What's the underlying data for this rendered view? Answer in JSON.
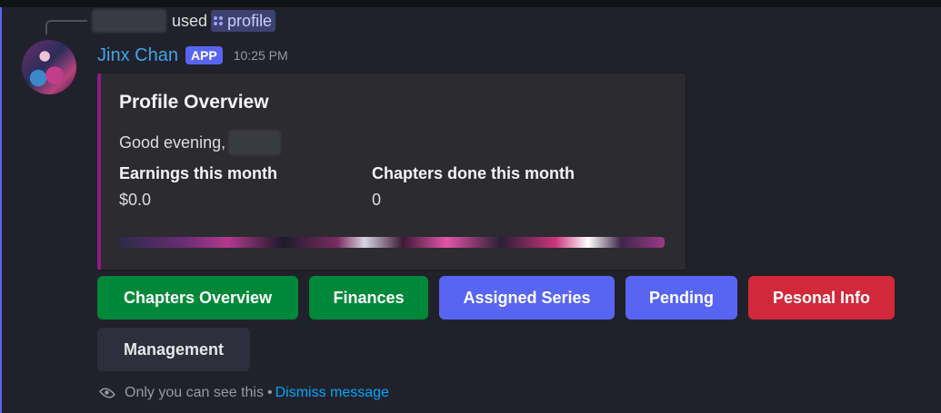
{
  "reply": {
    "used_text": "used",
    "command": "profile",
    "command_icon": "slash-command-icon"
  },
  "message": {
    "author": "Jinx Chan",
    "badge": "APP",
    "timestamp": "10:25 PM",
    "author_color": "#3fa7e6",
    "avatar_icon": "avatar-image"
  },
  "embed": {
    "accent_color": "#8d1d82",
    "title": "Profile Overview",
    "greeting": "Good evening,",
    "fields": [
      {
        "name": "Earnings this month",
        "value": "$0.0"
      },
      {
        "name": "Chapters done this month",
        "value": "0"
      }
    ]
  },
  "buttons": [
    {
      "label": "Chapters Overview",
      "color": "#00883a"
    },
    {
      "label": "Finances",
      "color": "#00883a"
    },
    {
      "label": "Assigned Series",
      "color": "#5865f2"
    },
    {
      "label": "Pending",
      "color": "#5865f2"
    },
    {
      "label": "Pesonal Info",
      "color": "#d1293a"
    },
    {
      "label": "Management",
      "color": "#2e2f3b"
    }
  ],
  "footer": {
    "notice": "Only you can see this",
    "separator": "•",
    "dismiss": "Dismiss message",
    "icon": "eye-icon"
  }
}
